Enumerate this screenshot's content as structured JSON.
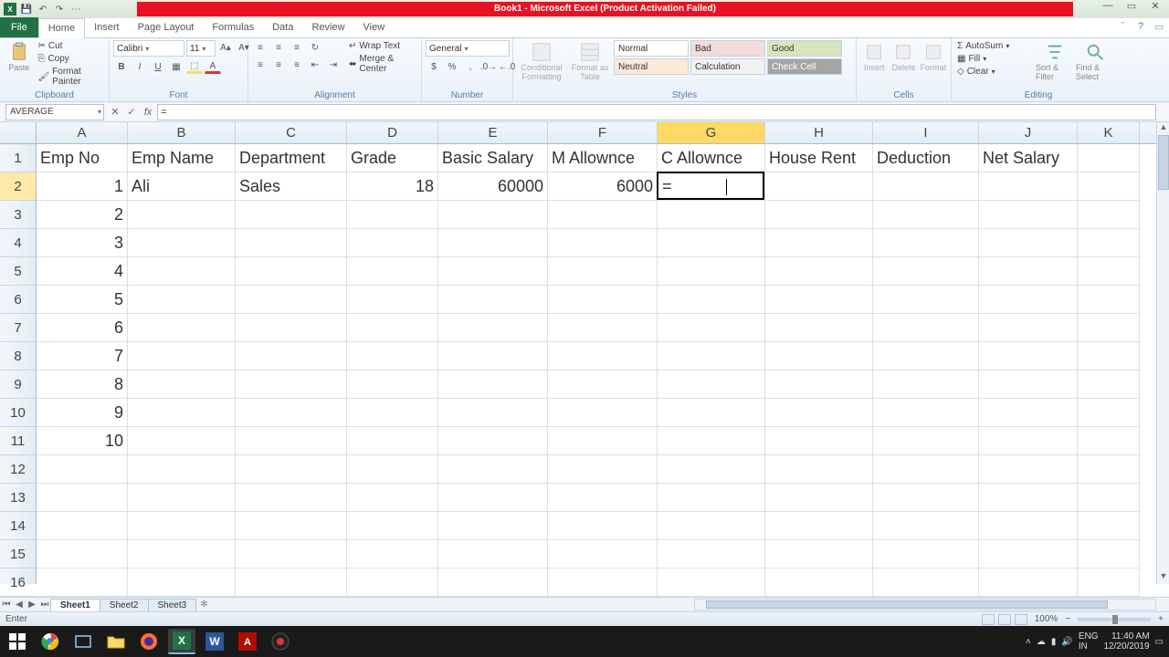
{
  "title_banner": "Book1 - Microsoft Excel (Product Activation Failed)",
  "tabs": {
    "file": "File",
    "items": [
      "Home",
      "Insert",
      "Page Layout",
      "Formulas",
      "Data",
      "Review",
      "View"
    ],
    "active": "Home"
  },
  "ribbon": {
    "clipboard": {
      "label": "Clipboard",
      "paste": "Paste",
      "cut": "Cut",
      "copy": "Copy",
      "fp": "Format Painter"
    },
    "font": {
      "label": "Font",
      "name": "Calibri",
      "size": "11"
    },
    "alignment": {
      "label": "Alignment",
      "wrap": "Wrap Text",
      "merge": "Merge & Center"
    },
    "number": {
      "label": "Number",
      "format": "General"
    },
    "styles": {
      "label": "Styles",
      "cond": "Conditional Formatting",
      "fat": "Format as Table",
      "cells": [
        "Normal",
        "Bad",
        "Good",
        "Neutral",
        "Calculation",
        "Check Cell"
      ]
    },
    "cells_grp": {
      "label": "Cells",
      "insert": "Insert",
      "delete": "Delete",
      "format": "Format"
    },
    "editing": {
      "label": "Editing",
      "autosum": "AutoSum",
      "fill": "Fill",
      "clear": "Clear",
      "sort": "Sort & Filter",
      "find": "Find & Select"
    }
  },
  "name_box": "AVERAGE",
  "formula": "=",
  "columns": [
    "A",
    "B",
    "C",
    "D",
    "E",
    "F",
    "G",
    "H",
    "I",
    "J",
    "K"
  ],
  "active_col": "G",
  "active_row": 2,
  "headers_row": [
    "Emp No",
    "Emp Name",
    "Department",
    "Grade",
    "Basic Salary",
    "M Allownce",
    "C Allownce",
    "House Rent",
    "Deduction",
    "Net Salary",
    ""
  ],
  "data_rows": [
    [
      "1",
      "Ali",
      "Sales",
      "18",
      "60000",
      "6000",
      "=",
      "",
      "",
      "",
      ""
    ],
    [
      "2",
      "",
      "",
      "",
      "",
      "",
      "",
      "",
      "",
      "",
      ""
    ],
    [
      "3",
      "",
      "",
      "",
      "",
      "",
      "",
      "",
      "",
      "",
      ""
    ],
    [
      "4",
      "",
      "",
      "",
      "",
      "",
      "",
      "",
      "",
      "",
      ""
    ],
    [
      "5",
      "",
      "",
      "",
      "",
      "",
      "",
      "",
      "",
      "",
      ""
    ],
    [
      "6",
      "",
      "",
      "",
      "",
      "",
      "",
      "",
      "",
      "",
      ""
    ],
    [
      "7",
      "",
      "",
      "",
      "",
      "",
      "",
      "",
      "",
      "",
      ""
    ],
    [
      "8",
      "",
      "",
      "",
      "",
      "",
      "",
      "",
      "",
      "",
      ""
    ],
    [
      "9",
      "",
      "",
      "",
      "",
      "",
      "",
      "",
      "",
      "",
      ""
    ],
    [
      "10",
      "",
      "",
      "",
      "",
      "",
      "",
      "",
      "",
      "",
      ""
    ],
    [
      "",
      "",
      "",
      "",
      "",
      "",
      "",
      "",
      "",
      "",
      ""
    ],
    [
      "",
      "",
      "",
      "",
      "",
      "",
      "",
      "",
      "",
      "",
      ""
    ],
    [
      "",
      "",
      "",
      "",
      "",
      "",
      "",
      "",
      "",
      "",
      ""
    ],
    [
      "",
      "",
      "",
      "",
      "",
      "",
      "",
      "",
      "",
      "",
      ""
    ],
    [
      "",
      "",
      "",
      "",
      "",
      "",
      "",
      "",
      "",
      "",
      ""
    ]
  ],
  "col_classes": [
    "col-A",
    "col-B",
    "col-C",
    "col-D",
    "col-E",
    "col-F",
    "col-G",
    "col-H",
    "col-I",
    "col-J",
    "col-K"
  ],
  "numeric_cols": [
    0,
    3,
    4,
    5
  ],
  "sheets": [
    "Sheet1",
    "Sheet2",
    "Sheet3"
  ],
  "active_sheet": "Sheet1",
  "status": "Enter",
  "zoom": "100%",
  "clock": {
    "time": "11:40 AM",
    "date": "12/20/2019",
    "lang": "ENG",
    "kb": "IN"
  }
}
